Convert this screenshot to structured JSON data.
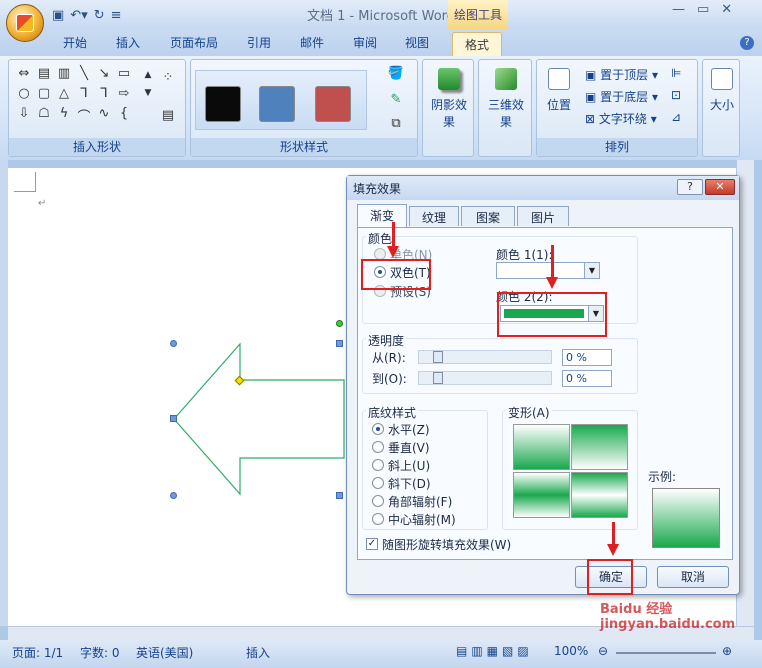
{
  "window": {
    "title": "文档 1 - Microsoft Word",
    "context_tools": "绘图工具"
  },
  "tabs": [
    "开始",
    "插入",
    "页面布局",
    "引用",
    "邮件",
    "审阅",
    "视图",
    "格式"
  ],
  "active_tab": "格式",
  "ribbon": {
    "groups": {
      "insert_shapes": "插入形状",
      "shape_styles": "形状样式",
      "shadow": "阴影效果",
      "threed": "三维效果",
      "arrange": "排列",
      "size": "大小"
    },
    "arrange_items": {
      "position": "位置",
      "bring_front": "置于顶层",
      "send_back": "置于底层",
      "text_wrap": "文字环绕"
    },
    "swatch_colors": [
      "#0a0a0a",
      "#4f81bd",
      "#c0504d"
    ]
  },
  "dialog": {
    "title": "填充效果",
    "help": "?",
    "tabs": [
      "渐变",
      "纹理",
      "图案",
      "图片"
    ],
    "active_tab": "渐变",
    "colors_label": "颜色",
    "color_options": [
      "单色(N)",
      "双色(T)",
      "预设(S)"
    ],
    "selected_color_option": "双色(T)",
    "color1_label": "颜色 1(1):",
    "color2_label": "颜色 2(2):",
    "color1_value": "#ffffff",
    "color2_value": "#1aa84e",
    "transparency_label": "透明度",
    "from_label": "从(R):",
    "to_label": "到(O):",
    "from_value": "0 %",
    "to_value": "0 %",
    "shading_label": "底纹样式",
    "shading_options": [
      "水平(Z)",
      "垂直(V)",
      "斜上(U)",
      "斜下(D)",
      "角部辐射(F)",
      "中心辐射(M)"
    ],
    "selected_shading": "水平(Z)",
    "variants_label": "变形(A)",
    "sample_label": "示例:",
    "rotate_label": "随图形旋转填充效果(W)",
    "rotate_checked": true,
    "ok": "确定",
    "cancel": "取消"
  },
  "status": {
    "page": "页面: 1/1",
    "words": "字数: 0",
    "language": "英语(美国)",
    "mode": "插入",
    "zoom": "100%"
  },
  "watermark": "Baidu 经验 jingyan.baidu.com"
}
